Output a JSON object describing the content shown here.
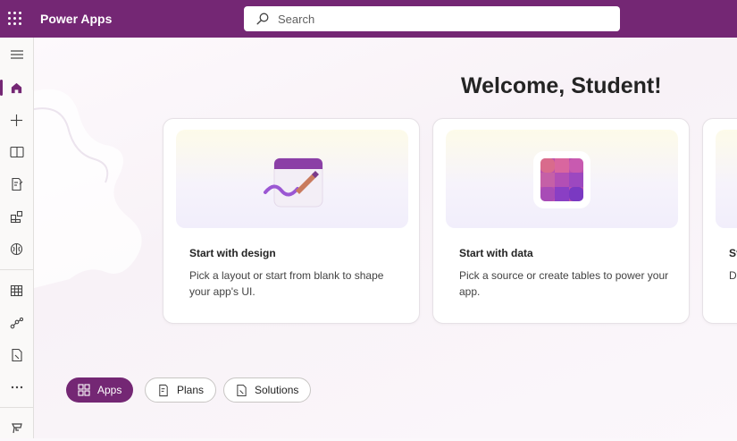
{
  "app": {
    "title": "Power Apps"
  },
  "search": {
    "placeholder": "Search"
  },
  "rail": {
    "items": [
      {
        "icon": "hamburger-icon"
      },
      {
        "icon": "home-icon",
        "active": true
      },
      {
        "icon": "plus-icon"
      },
      {
        "icon": "learn-book-icon"
      },
      {
        "icon": "edit-document-icon"
      },
      {
        "icon": "apps-grid-icon"
      },
      {
        "icon": "brain-icon"
      },
      {
        "icon": "table-icon"
      },
      {
        "icon": "flows-icon"
      },
      {
        "icon": "solutions-icon"
      },
      {
        "icon": "more-icon"
      },
      {
        "icon": "power-platform-icon"
      }
    ]
  },
  "main": {
    "welcome": "Welcome, Student!",
    "cards": [
      {
        "title": "Start with design",
        "description": "Pick a layout or start from blank to shape your app's UI."
      },
      {
        "title": "Start with data",
        "description": "Pick a source or create tables to power your app."
      },
      {
        "title": "St",
        "description": "D ge"
      }
    ],
    "pills": [
      {
        "label": "Apps",
        "active": true
      },
      {
        "label": "Plans",
        "active": false
      },
      {
        "label": "Solutions",
        "active": false
      }
    ]
  },
  "colors": {
    "brand": "#742774",
    "background": "#fbf8fb"
  }
}
